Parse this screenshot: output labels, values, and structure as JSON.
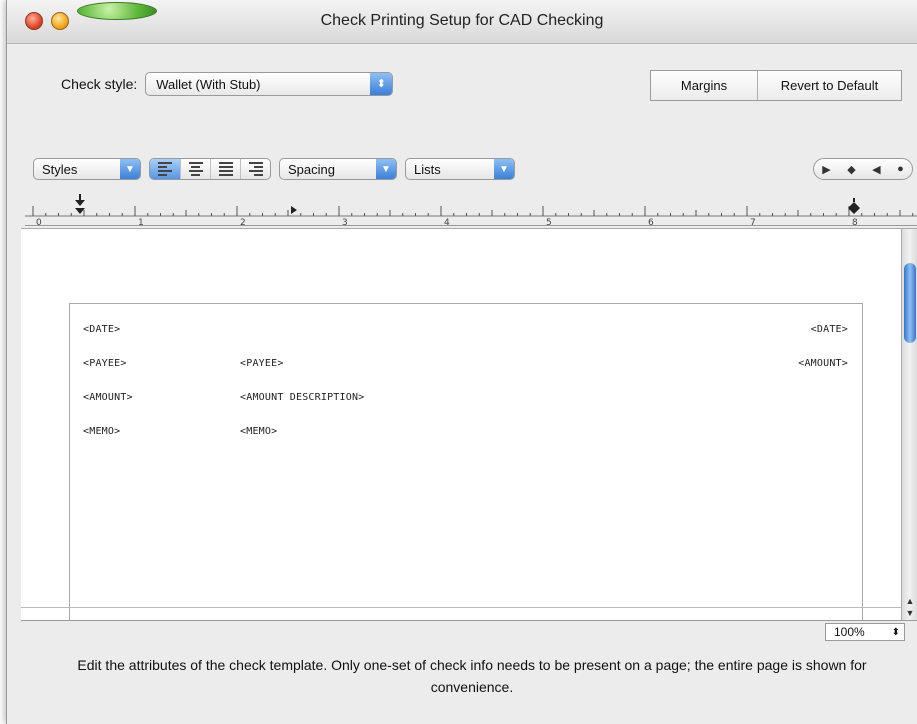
{
  "window": {
    "title": "Check Printing Setup for  CAD Checking"
  },
  "check_style": {
    "label": "Check style:",
    "value": "Wallet (With Stub)"
  },
  "buttons": {
    "margins": "Margins",
    "revert": "Revert to Default"
  },
  "toolbar": {
    "styles": "Styles",
    "spacing": "Spacing",
    "lists": "Lists",
    "alignments": [
      "align-left",
      "align-center",
      "align-justify",
      "align-right"
    ]
  },
  "ruler": {
    "numbers": [
      "0",
      "1",
      "2",
      "3",
      "4",
      "5",
      "6",
      "7",
      "8"
    ]
  },
  "template": {
    "date_left": "<DATE>",
    "date_right": "<DATE>",
    "payee_left": "<PAYEE>",
    "payee_mid": "<PAYEE>",
    "amount_right": "<AMOUNT>",
    "amount_left": "<AMOUNT>",
    "amount_desc": "<AMOUNT DESCRIPTION>",
    "memo_left": "<MEMO>",
    "memo_mid": "<MEMO>"
  },
  "zoom": {
    "value": "100%"
  },
  "help_text": "Edit the attributes of the check template.  Only one-set of check info needs to be present on a page; the entire page is shown for convenience."
}
